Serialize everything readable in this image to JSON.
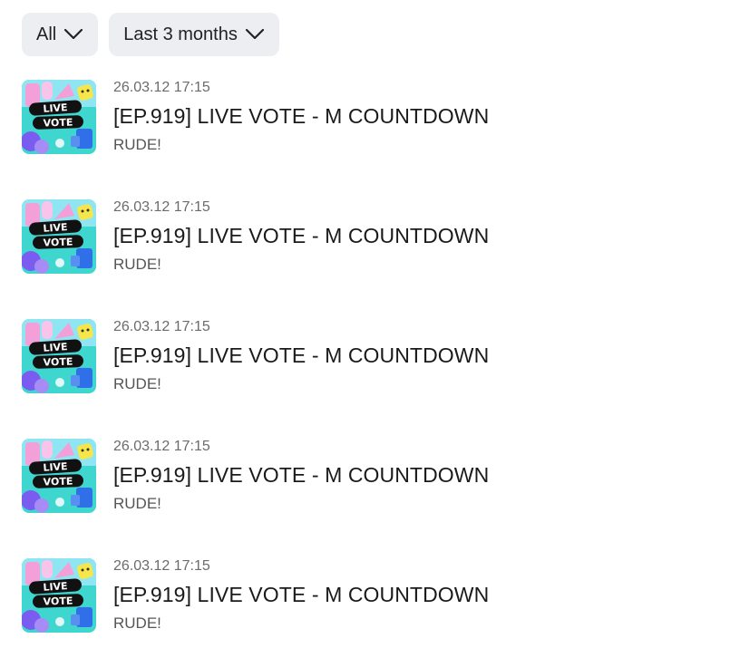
{
  "filters": {
    "type_label": "All",
    "range_label": "Last 3 months"
  },
  "thumbnail": {
    "line1": "LIVE",
    "line2": "VOTE",
    "colors": {
      "background": "#3fd6d0",
      "pink": "#f3a0d8",
      "blue": "#2f6fe8",
      "yellow": "#f7e64a",
      "purple": "#7b5cf0",
      "banner": "#111111"
    }
  },
  "items": [
    {
      "date": "26.03.12 17:15",
      "title": "[EP.919] LIVE VOTE - M COUNTDOWN",
      "subtitle": "RUDE!"
    },
    {
      "date": "26.03.12 17:15",
      "title": "[EP.919] LIVE VOTE - M COUNTDOWN",
      "subtitle": "RUDE!"
    },
    {
      "date": "26.03.12 17:15",
      "title": "[EP.919] LIVE VOTE - M COUNTDOWN",
      "subtitle": "RUDE!"
    },
    {
      "date": "26.03.12 17:15",
      "title": "[EP.919] LIVE VOTE - M COUNTDOWN",
      "subtitle": "RUDE!"
    },
    {
      "date": "26.03.12 17:15",
      "title": "[EP.919] LIVE VOTE - M COUNTDOWN",
      "subtitle": "RUDE!"
    }
  ]
}
